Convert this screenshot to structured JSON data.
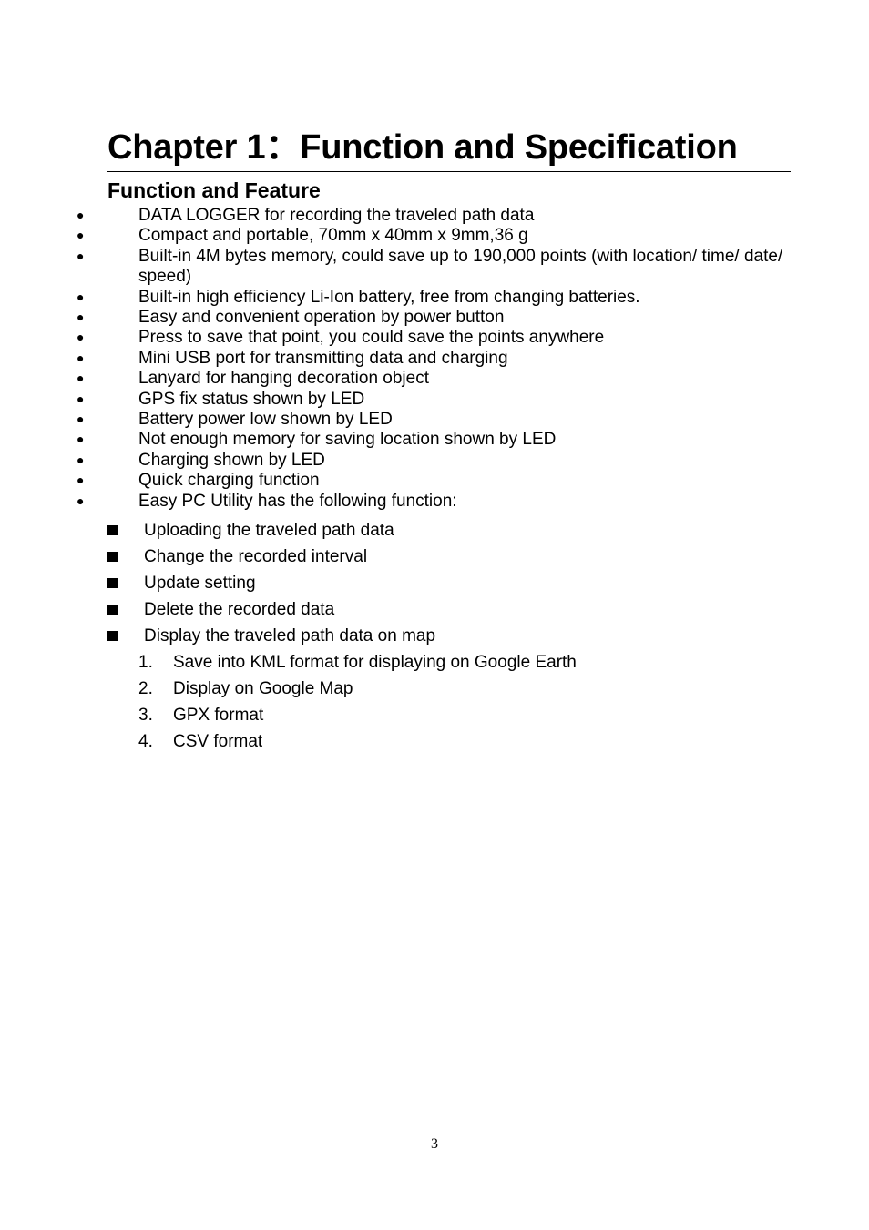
{
  "document": {
    "chapter_title": "Chapter 1：Function and Specification",
    "section_heading": "Function and Feature",
    "page_number": "3",
    "bullet_marker": "filled-circle",
    "square_marker": "filled-square",
    "text_color": "#000000",
    "background_color": "#ffffff"
  },
  "features": [
    {
      "text": "DATA LOGGER for recording the traveled path data"
    },
    {
      "text": "Compact and portable, 70mm x 40mm x 9mm,36 g"
    },
    {
      "text": "Built-in 4M bytes memory, could save up to 190,000 points (with location/ time/ date/ speed)"
    },
    {
      "text": "Built-in high efficiency Li-Ion battery, free from changing batteries."
    },
    {
      "text": "Easy and convenient operation by power button"
    },
    {
      "text": "Press to save that point, you could save the points anywhere"
    },
    {
      "text": "Mini USB port for transmitting data and charging"
    },
    {
      "text": "Lanyard for hanging decoration object"
    },
    {
      "text": "GPS fix status shown by LED"
    },
    {
      "text": "Battery power low shown by LED"
    },
    {
      "text": "Not enough memory for saving location shown by LED"
    },
    {
      "text": "Charging shown by LED"
    },
    {
      "text": "Quick charging function"
    },
    {
      "text": "Easy PC Utility has the following function:"
    }
  ],
  "utility_functions": [
    {
      "text": "Uploading the traveled path data"
    },
    {
      "text": "Change the recorded interval"
    },
    {
      "text": "Update setting"
    },
    {
      "text": "Delete the recorded data"
    },
    {
      "text": "Display the traveled path data on map"
    }
  ],
  "map_formats": [
    {
      "number": "1.",
      "text": "Save into KML format for displaying on Google Earth"
    },
    {
      "number": "2.",
      "text": "Display on Google Map"
    },
    {
      "number": "3.",
      "text": "GPX format"
    },
    {
      "number": "4.",
      "text": "CSV format"
    }
  ]
}
